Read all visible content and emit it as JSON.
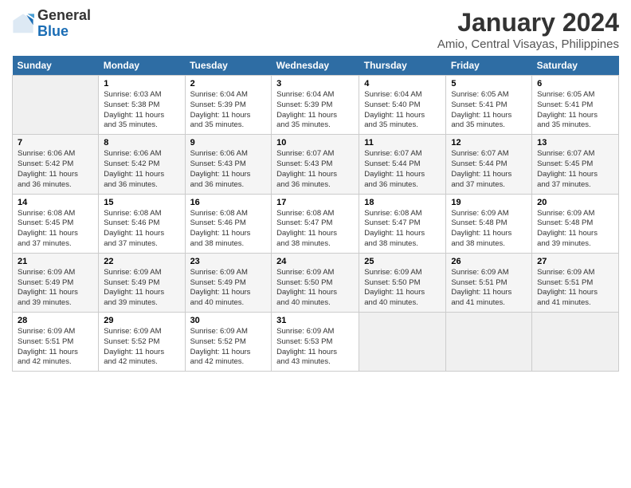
{
  "logo": {
    "line1": "General",
    "line2": "Blue"
  },
  "title": "January 2024",
  "subtitle": "Amio, Central Visayas, Philippines",
  "days_header": [
    "Sunday",
    "Monday",
    "Tuesday",
    "Wednesday",
    "Thursday",
    "Friday",
    "Saturday"
  ],
  "weeks": [
    [
      {
        "num": "",
        "info": ""
      },
      {
        "num": "1",
        "info": "Sunrise: 6:03 AM\nSunset: 5:38 PM\nDaylight: 11 hours\nand 35 minutes."
      },
      {
        "num": "2",
        "info": "Sunrise: 6:04 AM\nSunset: 5:39 PM\nDaylight: 11 hours\nand 35 minutes."
      },
      {
        "num": "3",
        "info": "Sunrise: 6:04 AM\nSunset: 5:39 PM\nDaylight: 11 hours\nand 35 minutes."
      },
      {
        "num": "4",
        "info": "Sunrise: 6:04 AM\nSunset: 5:40 PM\nDaylight: 11 hours\nand 35 minutes."
      },
      {
        "num": "5",
        "info": "Sunrise: 6:05 AM\nSunset: 5:41 PM\nDaylight: 11 hours\nand 35 minutes."
      },
      {
        "num": "6",
        "info": "Sunrise: 6:05 AM\nSunset: 5:41 PM\nDaylight: 11 hours\nand 35 minutes."
      }
    ],
    [
      {
        "num": "7",
        "info": "Sunrise: 6:06 AM\nSunset: 5:42 PM\nDaylight: 11 hours\nand 36 minutes."
      },
      {
        "num": "8",
        "info": "Sunrise: 6:06 AM\nSunset: 5:42 PM\nDaylight: 11 hours\nand 36 minutes."
      },
      {
        "num": "9",
        "info": "Sunrise: 6:06 AM\nSunset: 5:43 PM\nDaylight: 11 hours\nand 36 minutes."
      },
      {
        "num": "10",
        "info": "Sunrise: 6:07 AM\nSunset: 5:43 PM\nDaylight: 11 hours\nand 36 minutes."
      },
      {
        "num": "11",
        "info": "Sunrise: 6:07 AM\nSunset: 5:44 PM\nDaylight: 11 hours\nand 36 minutes."
      },
      {
        "num": "12",
        "info": "Sunrise: 6:07 AM\nSunset: 5:44 PM\nDaylight: 11 hours\nand 37 minutes."
      },
      {
        "num": "13",
        "info": "Sunrise: 6:07 AM\nSunset: 5:45 PM\nDaylight: 11 hours\nand 37 minutes."
      }
    ],
    [
      {
        "num": "14",
        "info": "Sunrise: 6:08 AM\nSunset: 5:45 PM\nDaylight: 11 hours\nand 37 minutes."
      },
      {
        "num": "15",
        "info": "Sunrise: 6:08 AM\nSunset: 5:46 PM\nDaylight: 11 hours\nand 37 minutes."
      },
      {
        "num": "16",
        "info": "Sunrise: 6:08 AM\nSunset: 5:46 PM\nDaylight: 11 hours\nand 38 minutes."
      },
      {
        "num": "17",
        "info": "Sunrise: 6:08 AM\nSunset: 5:47 PM\nDaylight: 11 hours\nand 38 minutes."
      },
      {
        "num": "18",
        "info": "Sunrise: 6:08 AM\nSunset: 5:47 PM\nDaylight: 11 hours\nand 38 minutes."
      },
      {
        "num": "19",
        "info": "Sunrise: 6:09 AM\nSunset: 5:48 PM\nDaylight: 11 hours\nand 38 minutes."
      },
      {
        "num": "20",
        "info": "Sunrise: 6:09 AM\nSunset: 5:48 PM\nDaylight: 11 hours\nand 39 minutes."
      }
    ],
    [
      {
        "num": "21",
        "info": "Sunrise: 6:09 AM\nSunset: 5:49 PM\nDaylight: 11 hours\nand 39 minutes."
      },
      {
        "num": "22",
        "info": "Sunrise: 6:09 AM\nSunset: 5:49 PM\nDaylight: 11 hours\nand 39 minutes."
      },
      {
        "num": "23",
        "info": "Sunrise: 6:09 AM\nSunset: 5:49 PM\nDaylight: 11 hours\nand 40 minutes."
      },
      {
        "num": "24",
        "info": "Sunrise: 6:09 AM\nSunset: 5:50 PM\nDaylight: 11 hours\nand 40 minutes."
      },
      {
        "num": "25",
        "info": "Sunrise: 6:09 AM\nSunset: 5:50 PM\nDaylight: 11 hours\nand 40 minutes."
      },
      {
        "num": "26",
        "info": "Sunrise: 6:09 AM\nSunset: 5:51 PM\nDaylight: 11 hours\nand 41 minutes."
      },
      {
        "num": "27",
        "info": "Sunrise: 6:09 AM\nSunset: 5:51 PM\nDaylight: 11 hours\nand 41 minutes."
      }
    ],
    [
      {
        "num": "28",
        "info": "Sunrise: 6:09 AM\nSunset: 5:51 PM\nDaylight: 11 hours\nand 42 minutes."
      },
      {
        "num": "29",
        "info": "Sunrise: 6:09 AM\nSunset: 5:52 PM\nDaylight: 11 hours\nand 42 minutes."
      },
      {
        "num": "30",
        "info": "Sunrise: 6:09 AM\nSunset: 5:52 PM\nDaylight: 11 hours\nand 42 minutes."
      },
      {
        "num": "31",
        "info": "Sunrise: 6:09 AM\nSunset: 5:53 PM\nDaylight: 11 hours\nand 43 minutes."
      },
      {
        "num": "",
        "info": ""
      },
      {
        "num": "",
        "info": ""
      },
      {
        "num": "",
        "info": ""
      }
    ]
  ]
}
